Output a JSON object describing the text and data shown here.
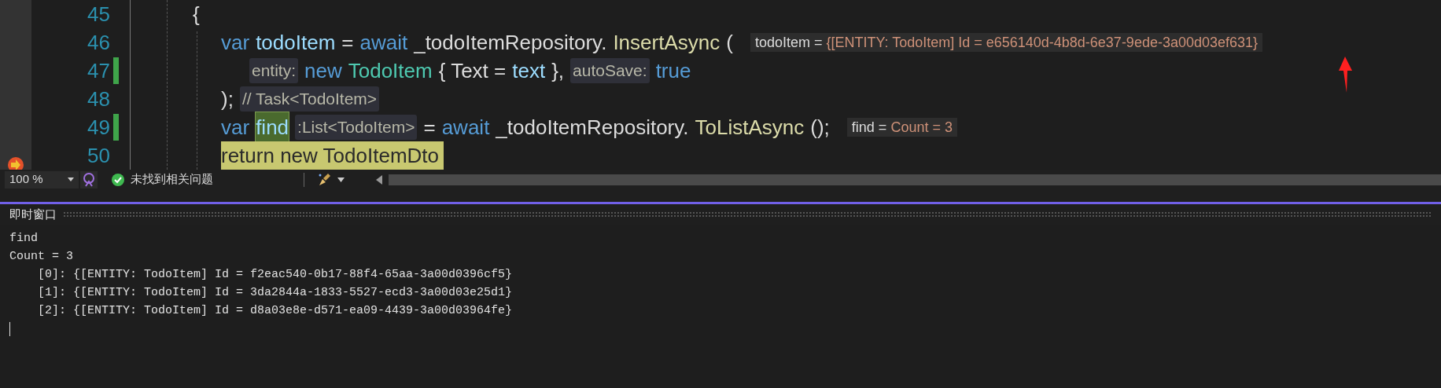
{
  "editor": {
    "lines": [
      {
        "number": "45",
        "changed": false,
        "current": false,
        "tokens": [
          {
            "kind": "plain",
            "text": "{"
          }
        ]
      },
      {
        "number": "46",
        "changed": false,
        "current": false,
        "tokens": [
          {
            "kind": "keyword",
            "text": "var"
          },
          {
            "kind": "identifier",
            "text": "todoItem"
          },
          {
            "kind": "plain",
            "text": "="
          },
          {
            "kind": "keyword",
            "text": "await"
          },
          {
            "kind": "plain",
            "text": "_todoItemRepository."
          },
          {
            "kind": "method",
            "text": "InsertAsync"
          },
          {
            "kind": "plain",
            "text": "("
          }
        ],
        "datatip": {
          "name": "todoItem =",
          "value": "{[ENTITY: TodoItem] Id = e656140d-4b8d-6e37-9ede-3a00d03ef631}"
        }
      },
      {
        "number": "47",
        "changed": true,
        "current": false,
        "tokens": [
          {
            "kind": "hint",
            "text": "entity:"
          },
          {
            "kind": "keyword",
            "text": "new"
          },
          {
            "kind": "type",
            "text": "TodoItem"
          },
          {
            "kind": "plain",
            "text": "{ Text ="
          },
          {
            "kind": "identifier",
            "text": "text"
          },
          {
            "kind": "plain",
            "text": "},"
          },
          {
            "kind": "hint",
            "text": "autoSave:"
          },
          {
            "kind": "keyword",
            "text": "true"
          }
        ]
      },
      {
        "number": "48",
        "changed": false,
        "current": false,
        "tokens": [
          {
            "kind": "plain",
            "text": ");"
          },
          {
            "kind": "hint",
            "text": "// Task<TodoItem>"
          }
        ]
      },
      {
        "number": "49",
        "changed": true,
        "current": false,
        "tokens": [
          {
            "kind": "keyword",
            "text": "var"
          },
          {
            "kind": "identifier",
            "text": "find",
            "highlighted": true
          },
          {
            "kind": "hint",
            "text": ":List<TodoItem>"
          },
          {
            "kind": "plain",
            "text": "="
          },
          {
            "kind": "keyword",
            "text": "await"
          },
          {
            "kind": "plain",
            "text": "_todoItemRepository."
          },
          {
            "kind": "method",
            "text": "ToListAsync"
          },
          {
            "kind": "plain",
            "text": "();"
          }
        ],
        "datatip": {
          "name": "find =",
          "value": "Count = 3"
        }
      },
      {
        "number": "50",
        "changed": false,
        "current": true,
        "tokens": [
          {
            "kind": "plain",
            "text": "return new TodoItemDto"
          }
        ]
      }
    ]
  },
  "status_bar": {
    "zoom": "100 %",
    "issues": "未找到相关问题"
  },
  "immediate_window": {
    "title": "即时窗口",
    "lines": [
      "find",
      "Count = 3",
      "    [0]: {[ENTITY: TodoItem] Id = f2eac540-0b17-88f4-65aa-3a00d0396cf5}",
      "    [1]: {[ENTITY: TodoItem] Id = 3da2844a-1833-5527-ecd3-3a00d03e25d1}",
      "    [2]: {[ENTITY: TodoItem] Id = d8a03e8e-d571-ea09-4439-3a00d03964fe}"
    ]
  }
}
